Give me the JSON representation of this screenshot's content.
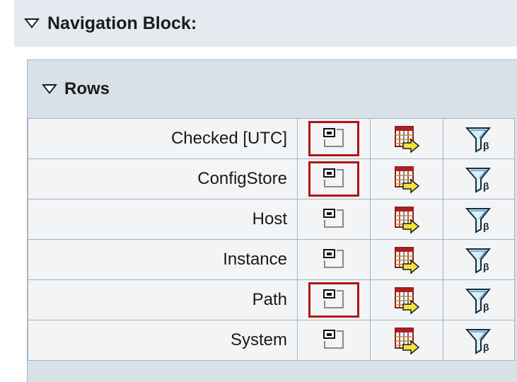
{
  "navigation_block": {
    "title": "Navigation Block:",
    "rows_section": {
      "title": "Rows",
      "items": [
        {
          "label": "Checked [UTC]",
          "layout_highlighted": true
        },
        {
          "label": "ConfigStore",
          "layout_highlighted": true
        },
        {
          "label": "Host",
          "layout_highlighted": false
        },
        {
          "label": "Instance",
          "layout_highlighted": false
        },
        {
          "label": "Path",
          "layout_highlighted": true
        },
        {
          "label": "System",
          "layout_highlighted": false
        }
      ],
      "icons": [
        "layout-icon",
        "table-swap-icon",
        "filter-icon"
      ]
    }
  },
  "colors": {
    "highlight_border": "#b01414",
    "header_bg": "#e4eaef",
    "rows_bg": "#d8e1e8",
    "cell_bg": "#f2f4f6"
  }
}
